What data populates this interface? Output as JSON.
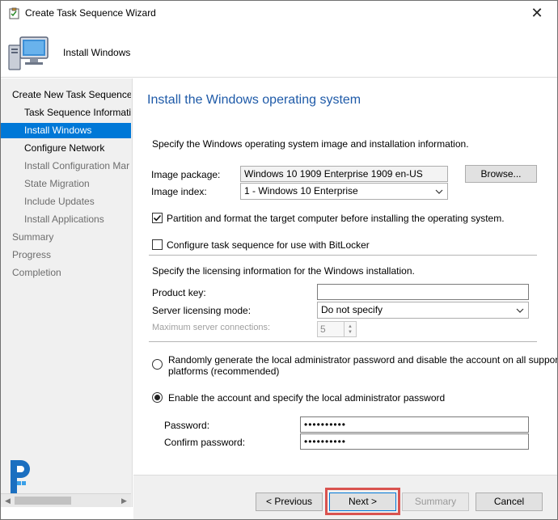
{
  "window": {
    "title": "Create Task Sequence Wizard",
    "close_glyph": "✕"
  },
  "banner": {
    "title": "Install Windows"
  },
  "nav": {
    "items": [
      {
        "label": "Create New Task Sequence"
      },
      {
        "label": "Task Sequence Informatio"
      },
      {
        "label": "Install Windows"
      },
      {
        "label": "Configure Network"
      },
      {
        "label": "Install Configuration Mar"
      },
      {
        "label": "State Migration"
      },
      {
        "label": "Include Updates"
      },
      {
        "label": "Install Applications"
      },
      {
        "label": "Summary"
      },
      {
        "label": "Progress"
      },
      {
        "label": "Completion"
      }
    ],
    "scroll_left": "◀",
    "scroll_right": "▶"
  },
  "content": {
    "heading": "Install the Windows operating system",
    "intro": "Specify the Windows operating system image and installation information.",
    "image_package_label": "Image package:",
    "image_package_value": "Windows 10 1909 Enterprise 1909 en-US",
    "browse_button": "Browse...",
    "image_index_label": "Image index:",
    "image_index_value": "1 - Windows 10 Enterprise",
    "partition_checkbox_label": "Partition and format the target computer before installing the operating system.",
    "partition_checked": true,
    "bitlocker_checkbox_label": "Configure task sequence for use with BitLocker",
    "bitlocker_checked": false,
    "licensing_intro": "Specify the licensing information for the Windows installation.",
    "product_key_label": "Product key:",
    "product_key_value": "",
    "server_licensing_label": "Server licensing mode:",
    "server_licensing_value": "Do not specify",
    "max_connections_label": "Maximum server connections:",
    "max_connections_value": "5",
    "radio_random_label": "Randomly generate the local administrator password and disable the account on all supported platforms (recommended)",
    "radio_random_line1": "Randomly generate the local administrator password and disable the account on all supported",
    "radio_random_line2": "platforms (recommended)",
    "radio_enable_label": "Enable the account and specify the local administrator password",
    "selected_radio": "enable",
    "password_label": "Password:",
    "password_value": "••••••••••",
    "confirm_password_label": "Confirm password:",
    "confirm_password_value": "••••••••••"
  },
  "footer": {
    "previous": "< Previous",
    "next": "Next >",
    "summary": "Summary",
    "cancel": "Cancel"
  },
  "colors": {
    "accent": "#0078d7",
    "heading": "#1e5aa8",
    "highlight": "#d9534f"
  },
  "icons": {
    "title": "wizard-clipboard-icon",
    "banner": "computer-monitor-icon",
    "logo": "prajwal-p-logo"
  }
}
